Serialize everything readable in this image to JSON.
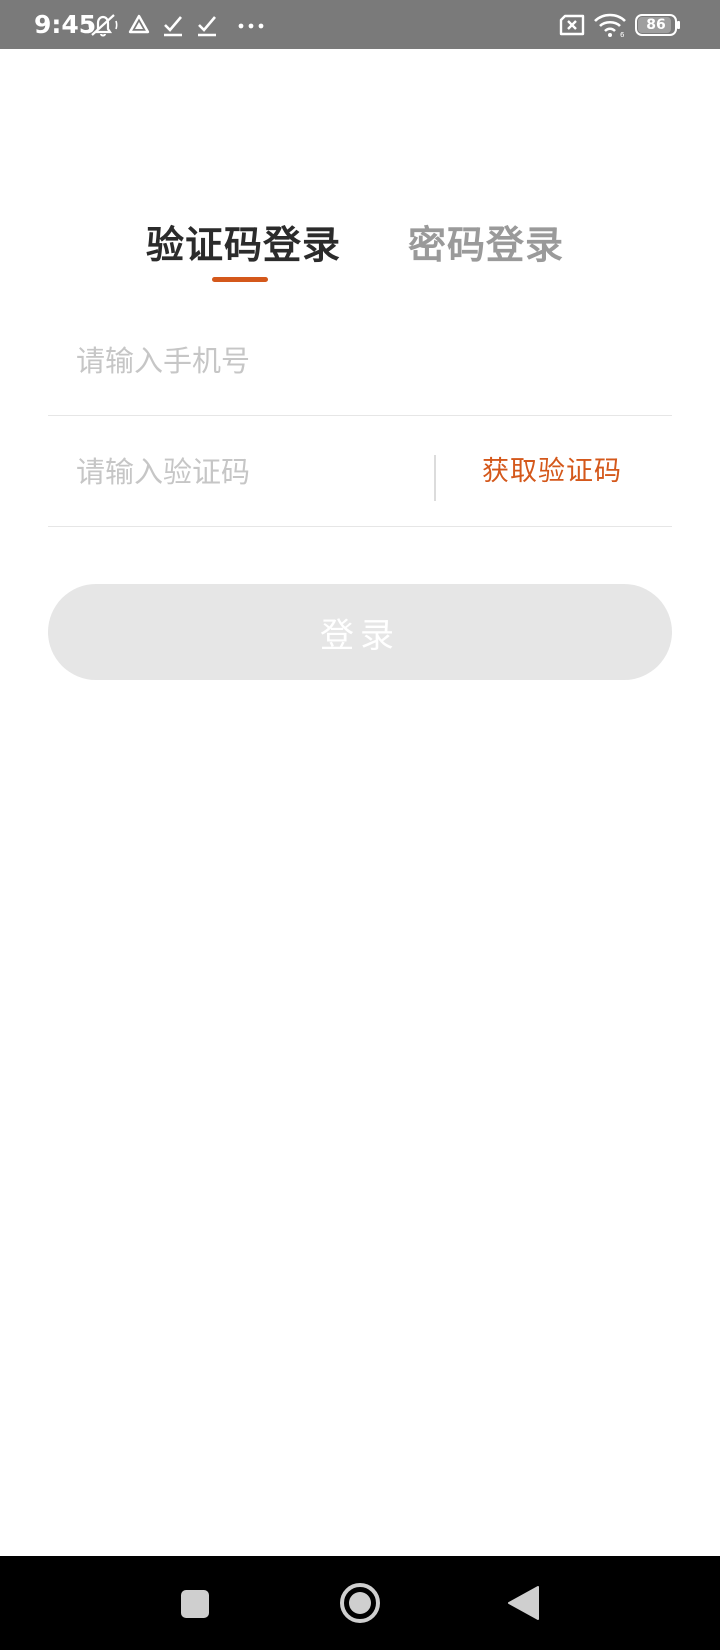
{
  "status_bar": {
    "time": "9:45",
    "battery_level": "86",
    "icons": [
      "mute-icon",
      "drive-icon",
      "check-icon",
      "check-icon",
      "more-dots-icon",
      "sim-error-icon",
      "wifi-icon",
      "battery-icon"
    ]
  },
  "login": {
    "tabs": [
      {
        "label": "验证码登录",
        "active": true
      },
      {
        "label": "密码登录",
        "active": false
      }
    ],
    "phone_placeholder": "请输入手机号",
    "phone_value": "",
    "code_placeholder": "请输入验证码",
    "code_value": "",
    "get_code_label": "获取验证码",
    "submit_label": "登录"
  },
  "nav_bar": {
    "buttons": [
      "recents",
      "home",
      "back"
    ]
  },
  "colors": {
    "accent": "#d4581b",
    "status_bar": "#7a7a7a",
    "button_disabled": "#e6e6e6",
    "tab_active": "#2b2b2b",
    "tab_inactive": "#9a9a9a",
    "placeholder": "#c6c6c6"
  }
}
